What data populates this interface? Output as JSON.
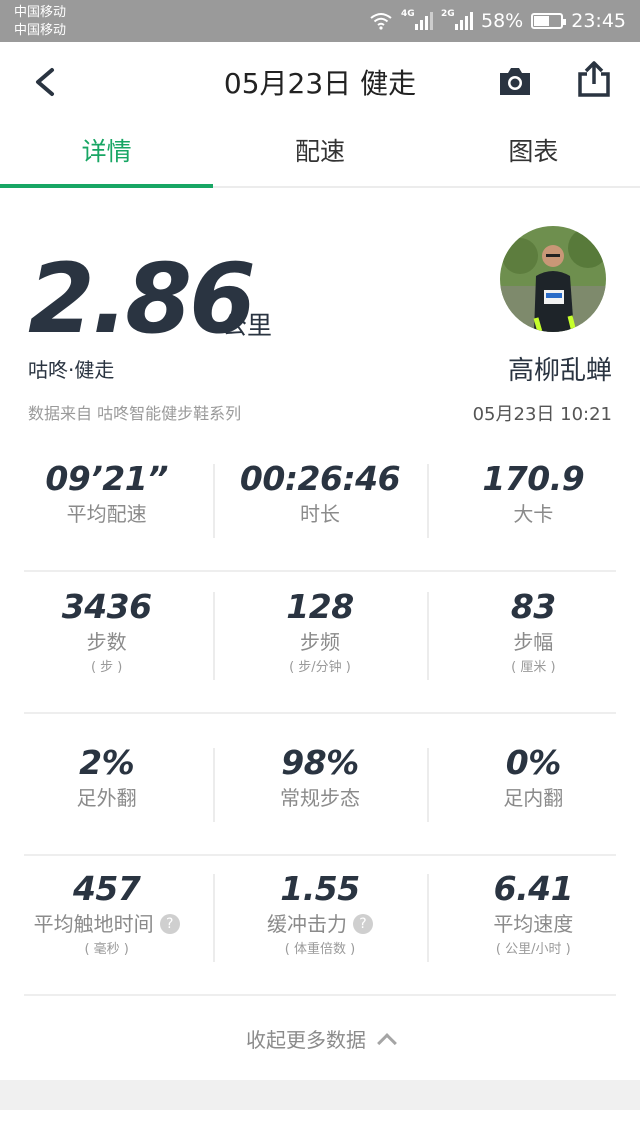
{
  "status_bar": {
    "carrier1": "中国移动",
    "carrier2": "中国移动",
    "signal1_tag": "4G",
    "signal2_tag": "2G",
    "battery_percent": "58%",
    "battery_level": 0.58,
    "time": "23:45"
  },
  "header": {
    "title": "05月23日 健走",
    "back_icon": "back-arrow-icon",
    "camera_icon": "camera-icon",
    "share_icon": "share-icon"
  },
  "tabs": [
    {
      "label": "详情",
      "active": true
    },
    {
      "label": "配速",
      "active": false
    },
    {
      "label": "图表",
      "active": false
    }
  ],
  "summary": {
    "distance": "2.86",
    "unit": "公里",
    "activity": "咕咚·健走",
    "source": "数据来自 咕咚智能健步鞋系列",
    "username": "高柳乱蝉",
    "datetime": "05月23日 10:21"
  },
  "stats_rows": [
    [
      {
        "value": "09’21”",
        "label": "平均配速"
      },
      {
        "value": "00:26:46",
        "label": "时长"
      },
      {
        "value": "170.9",
        "label": "大卡"
      }
    ],
    [
      {
        "value": "3436",
        "label": "步数",
        "sub": "( 步 )"
      },
      {
        "value": "128",
        "label": "步频",
        "sub": "( 步/分钟 )"
      },
      {
        "value": "83",
        "label": "步幅",
        "sub": "( 厘米 )"
      }
    ],
    [
      {
        "value": "2%",
        "label": "足外翻"
      },
      {
        "value": "98%",
        "label": "常规步态"
      },
      {
        "value": "0%",
        "label": "足内翻"
      }
    ],
    [
      {
        "value": "457",
        "label": "平均触地时间",
        "sub": "( 毫秒 )",
        "help": "?"
      },
      {
        "value": "1.55",
        "label": "缓冲击力",
        "sub": "( 体重倍数 )",
        "help": "?"
      },
      {
        "value": "6.41",
        "label": "平均速度",
        "sub": "( 公里/小时 )"
      }
    ]
  ],
  "collapse_label": "收起更多数据",
  "colors": {
    "accent": "#18a664",
    "text_dark": "#2a3441",
    "text_gray": "#8b8b8b"
  }
}
